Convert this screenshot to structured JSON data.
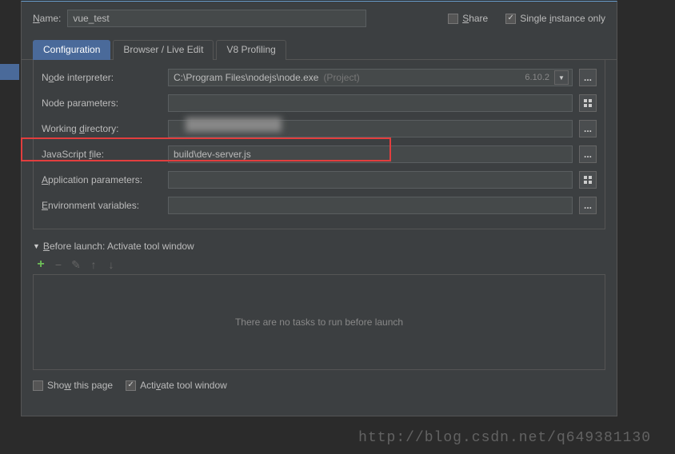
{
  "header": {
    "name_label_pre": "N",
    "name_label_post": "ame:",
    "name_value": "vue_test",
    "share_pre": "S",
    "share_post": "hare",
    "single_pre": "Single ",
    "single_u": "i",
    "single_post": "nstance only"
  },
  "tabs": {
    "configuration": "Configuration",
    "browser": "Browser / Live Edit",
    "v8": "V8 Profiling"
  },
  "fields": {
    "node_interp_pre": "N",
    "node_interp_u": "o",
    "node_interp_post": "de interpreter:",
    "node_interp_value": "C:\\Program Files\\nodejs\\node.exe",
    "node_interp_suffix": "(Project)",
    "node_interp_version": "6.10.2",
    "node_params_label": "Node parameters:",
    "node_params_value": "",
    "workdir_pre": "Working ",
    "workdir_u": "d",
    "workdir_post": "irectory:",
    "workdir_value": "",
    "jsfile_pre": "JavaScript ",
    "jsfile_u": "f",
    "jsfile_post": "ile:",
    "jsfile_value": "build\\dev-server.js",
    "app_params_pre": "A",
    "app_params_post": "pplication parameters:",
    "app_params_value": "",
    "env_pre": "E",
    "env_post": "nvironment variables:",
    "env_value": ""
  },
  "before_launch": {
    "title_pre": "B",
    "title_post": "efore launch: Activate tool window",
    "empty_text": "There are no tasks to run before launch"
  },
  "footer": {
    "show_pre": "Sho",
    "show_u": "w",
    "show_post": " this page",
    "activate_pre": "Acti",
    "activate_u": "v",
    "activate_post": "ate tool window"
  },
  "watermark": "http://blog.csdn.net/q649381130"
}
